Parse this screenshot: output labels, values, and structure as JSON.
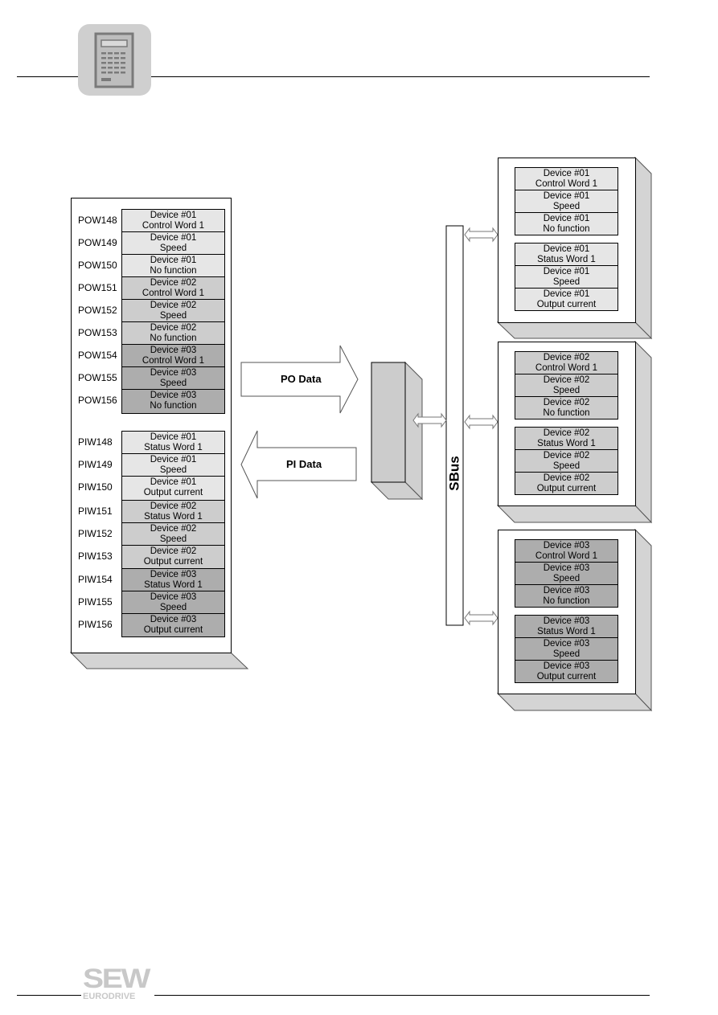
{
  "header": {
    "icon": "calculator-icon"
  },
  "master": {
    "po_registers": [
      {
        "reg": "POW148",
        "device": "Device #01",
        "function": "Control Word 1",
        "shade": 1
      },
      {
        "reg": "POW149",
        "device": "Device #01",
        "function": "Speed",
        "shade": 1
      },
      {
        "reg": "POW150",
        "device": "Device #01",
        "function": "No function",
        "shade": 1
      },
      {
        "reg": "POW151",
        "device": "Device #02",
        "function": "Control Word 1",
        "shade": 2
      },
      {
        "reg": "POW152",
        "device": "Device #02",
        "function": "Speed",
        "shade": 2
      },
      {
        "reg": "POW153",
        "device": "Device #02",
        "function": "No function",
        "shade": 2
      },
      {
        "reg": "POW154",
        "device": "Device #03",
        "function": "Control Word 1",
        "shade": 3
      },
      {
        "reg": "POW155",
        "device": "Device #03",
        "function": "Speed",
        "shade": 3
      },
      {
        "reg": "POW156",
        "device": "Device #03",
        "function": "No function",
        "shade": 3
      }
    ],
    "pi_registers": [
      {
        "reg": "PIW148",
        "device": "Device #01",
        "function": "Status Word 1",
        "shade": 1
      },
      {
        "reg": "PIW149",
        "device": "Device #01",
        "function": "Speed",
        "shade": 1
      },
      {
        "reg": "PIW150",
        "device": "Device #01",
        "function": "Output current",
        "shade": 1
      },
      {
        "reg": "PIW151",
        "device": "Device #02",
        "function": "Status Word 1",
        "shade": 2
      },
      {
        "reg": "PIW152",
        "device": "Device #02",
        "function": "Speed",
        "shade": 2
      },
      {
        "reg": "PIW153",
        "device": "Device #02",
        "function": "Output current",
        "shade": 2
      },
      {
        "reg": "PIW154",
        "device": "Device #03",
        "function": "Status Word 1",
        "shade": 3
      },
      {
        "reg": "PIW155",
        "device": "Device #03",
        "function": "Speed",
        "shade": 3
      },
      {
        "reg": "PIW156",
        "device": "Device #03",
        "function": "Output current",
        "shade": 3
      }
    ]
  },
  "arrows": {
    "po_label": "PO Data",
    "pi_label": "PI Data"
  },
  "bus": {
    "label": "SBus"
  },
  "devices": [
    {
      "shade": 1,
      "outputs": [
        {
          "device": "Device #01",
          "function": "Control Word 1"
        },
        {
          "device": "Device #01",
          "function": "Speed"
        },
        {
          "device": "Device #01",
          "function": "No function"
        }
      ],
      "inputs": [
        {
          "device": "Device #01",
          "function": "Status Word 1"
        },
        {
          "device": "Device #01",
          "function": "Speed"
        },
        {
          "device": "Device #01",
          "function": "Output current"
        }
      ]
    },
    {
      "shade": 2,
      "outputs": [
        {
          "device": "Device #02",
          "function": "Control Word 1"
        },
        {
          "device": "Device #02",
          "function": "Speed"
        },
        {
          "device": "Device #02",
          "function": "No function"
        }
      ],
      "inputs": [
        {
          "device": "Device #02",
          "function": "Status Word 1"
        },
        {
          "device": "Device #02",
          "function": "Speed"
        },
        {
          "device": "Device #02",
          "function": "Output current"
        }
      ]
    },
    {
      "shade": 3,
      "outputs": [
        {
          "device": "Device #03",
          "function": "Control Word 1"
        },
        {
          "device": "Device #03",
          "function": "Speed"
        },
        {
          "device": "Device #03",
          "function": "No function"
        }
      ],
      "inputs": [
        {
          "device": "Device #03",
          "function": "Status Word 1"
        },
        {
          "device": "Device #03",
          "function": "Speed"
        },
        {
          "device": "Device #03",
          "function": "Output current"
        }
      ]
    }
  ],
  "footer": {
    "logo_top": "SEW",
    "logo_bottom": "EURODRIVE"
  }
}
